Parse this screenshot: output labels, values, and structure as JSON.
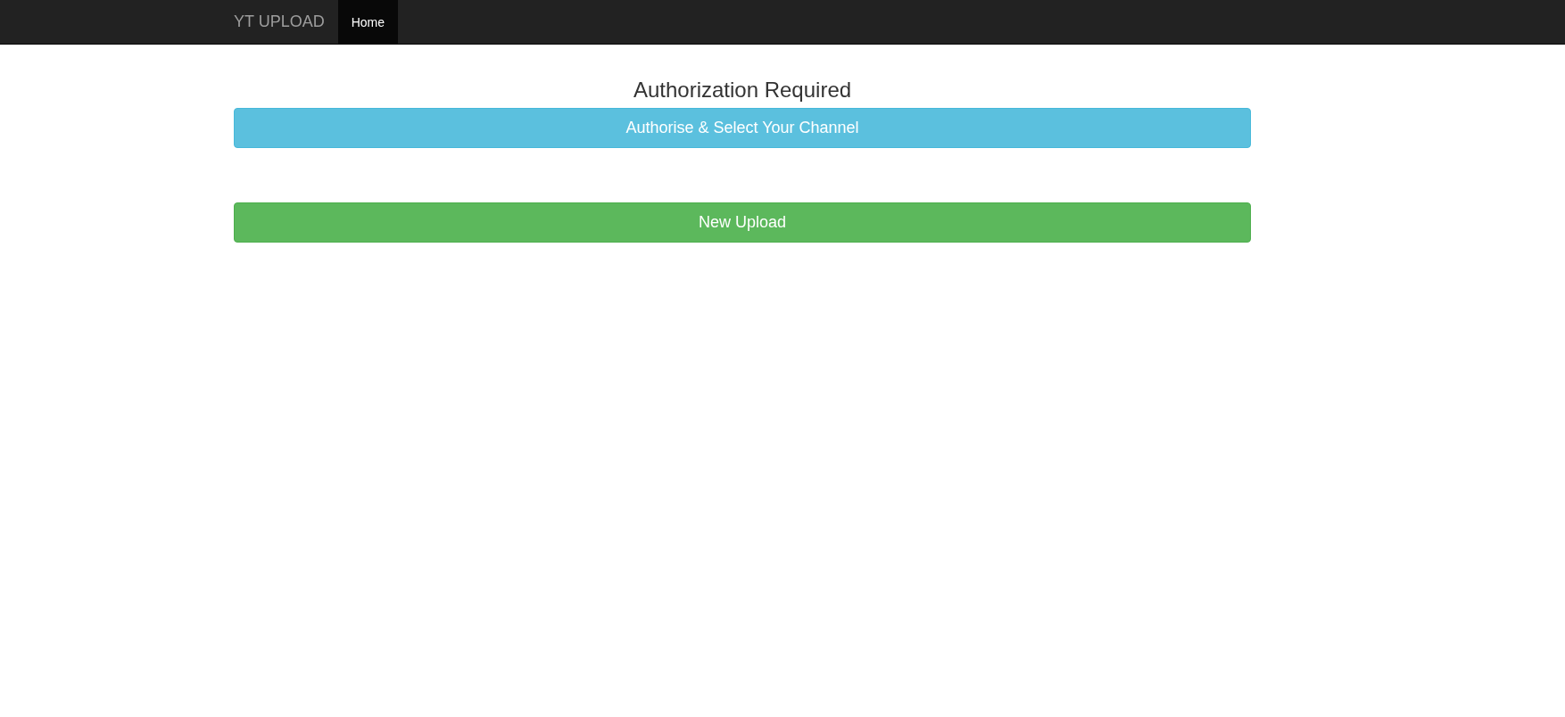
{
  "navbar": {
    "brand": "YT UPLOAD",
    "tabs": [
      {
        "label": "Home",
        "selected": true
      }
    ]
  },
  "heading": "Authorization Required",
  "buttons": [
    {
      "label": "Authorise & Select Your Channel",
      "kind": "info"
    },
    {
      "label": "New Upload",
      "kind": "success"
    }
  ]
}
